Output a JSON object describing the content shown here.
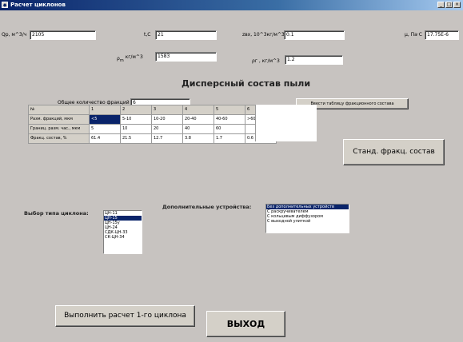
{
  "window": {
    "title": "Расчет циклонов"
  },
  "params": {
    "q_label": "Qр, м^3/ч",
    "q_value": "2105",
    "t_label": "t,C",
    "t_value": "21",
    "zvx_label": "zвх, 10^3кг/м^3",
    "zvx_value": "0.1",
    "mu_label": "μ, Па·С",
    "mu_value": "17.75Е-6",
    "rho_m_label": "ρ",
    "rho_m_sub": "m",
    "rho_m_unit": "кг/м^3",
    "rho_m_value": "1583",
    "rho_g_label": "ρг , кг/м^3",
    "rho_g_value": "1.2"
  },
  "dispersion": {
    "heading": "Дисперсный состав пыли",
    "fractions_label": "Общее количество фракций",
    "fractions_value": "6",
    "enter_table_button": "Ввести таблицу фракционного состава",
    "standard_button": "Станд. фракц. состав"
  },
  "table": {
    "header_row": [
      "№",
      "1",
      "2",
      "3",
      "4",
      "5",
      "6"
    ],
    "rows": [
      [
        "Разм. фракций, мкм",
        "<5",
        "5-10",
        "10-20",
        "20-40",
        "40-60",
        ">60"
      ],
      [
        "Границ. разм. час., мкм",
        "5",
        "10",
        "20",
        "40",
        "60",
        ""
      ],
      [
        "Фракц. состав, %",
        "61.4",
        "21.5",
        "12.7",
        "3.8",
        "1.7",
        "0.6"
      ]
    ]
  },
  "cyclone": {
    "label": "Выбор типа циклона:",
    "options": [
      "ЦН-11",
      "ЦН-15",
      "ЦН-15у",
      "ЦН-24",
      "СДК-ЦН-33",
      "СК-ЦН-34"
    ],
    "selected_index": 1
  },
  "devices": {
    "label": "Дополнительные устройства:",
    "options": [
      "Без дополнительных устройств",
      "С раскручивателем",
      "С кольцевым диффузором",
      "С выходной улиткой"
    ],
    "selected_index": 0
  },
  "actions": {
    "calculate_button": "Выполнить расчет 1-го циклона",
    "exit_button": "выход"
  }
}
